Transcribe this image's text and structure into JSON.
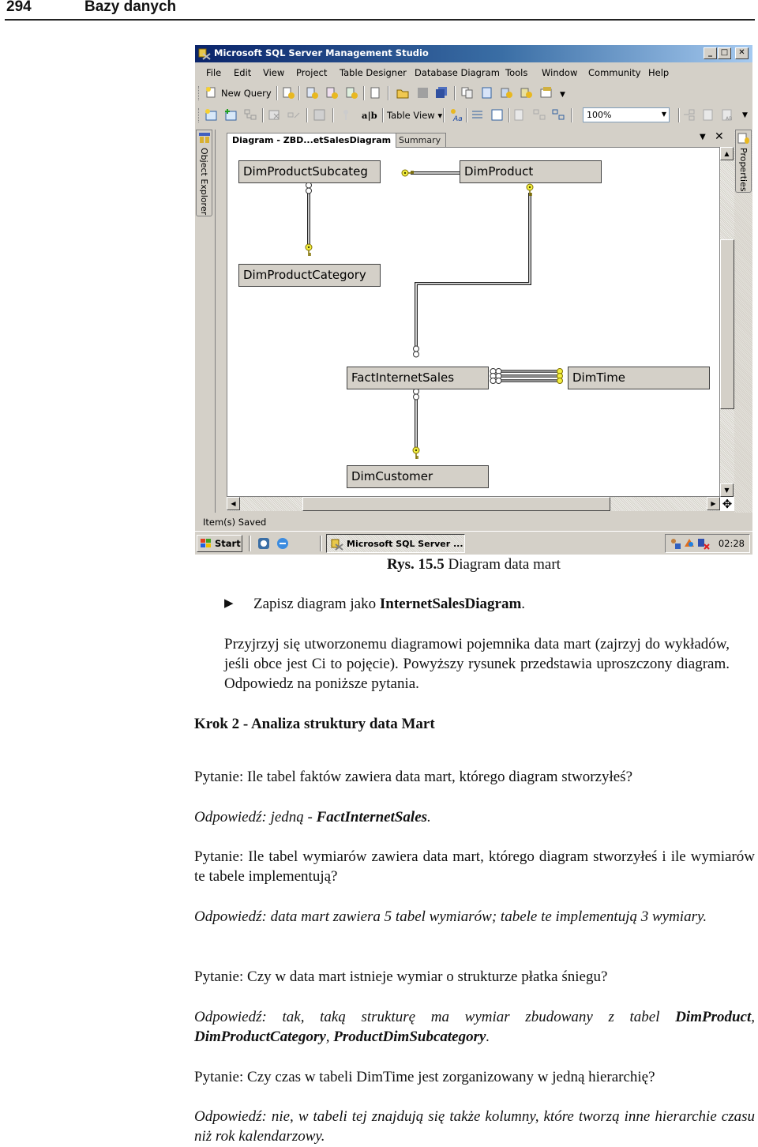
{
  "page_header": {
    "page_number": "294",
    "title": "Bazy danych"
  },
  "window": {
    "title": "Microsoft SQL Server Management Studio",
    "controls": {
      "minimize": "_",
      "maximize": "□",
      "close": "✕"
    },
    "menu": [
      "File",
      "Edit",
      "View",
      "Project",
      "Table Designer",
      "Database Diagram",
      "Tools",
      "Window",
      "Community",
      "Help"
    ],
    "toolbar1": {
      "new_query": "New Query"
    },
    "toolbar2": {
      "text_icon": "a|b",
      "table_view": "Table View ▾",
      "zoom_value": "100%"
    },
    "left_panel": "Object Explorer",
    "right_panel": "Properties",
    "tabs": [
      {
        "label": "Diagram - ZBD...etSalesDiagram",
        "active": true
      },
      {
        "label": "Summary",
        "active": false
      }
    ],
    "diagram": {
      "tables": [
        {
          "name": "DimProductSubcateg"
        },
        {
          "name": "DimProduct"
        },
        {
          "name": "DimProductCategory"
        },
        {
          "name": "FactInternetSales"
        },
        {
          "name": "DimTime"
        },
        {
          "name": "DimCustomer"
        }
      ],
      "relationships": [
        {
          "from": "DimProductSubcateg",
          "to": "DimProduct",
          "one_side": "DimProductSubcateg"
        },
        {
          "from": "DimProductCategory",
          "to": "DimProductSubcateg",
          "one_side": "DimProductCategory"
        },
        {
          "from": "DimProduct",
          "to": "FactInternetSales",
          "one_side": "DimProduct"
        },
        {
          "from": "DimTime",
          "to": "FactInternetSales",
          "one_side": "DimTime",
          "count": 3
        },
        {
          "from": "DimCustomer",
          "to": "FactInternetSales",
          "one_side": "DimCustomer"
        }
      ]
    },
    "status": "Item(s) Saved",
    "taskbar": {
      "start": "Start",
      "task": "Microsoft SQL Server ...",
      "clock": "02:28"
    }
  },
  "caption": {
    "label": "Rys. 15.5",
    "text": " Diagram data mart"
  },
  "bullet": {
    "text": "Zapisz diagram jako ",
    "bold": "InternetSalesDiagram",
    "end": "."
  },
  "intro": "Przyjrzyj się utworzonemu diagramowi pojemnika data mart (zajrzyj do wykładów, jeśli obce jest Ci to pojęcie). Powyższy rysunek przedstawia uproszczony diagram. Odpowiedz na poniższe pytania.",
  "section_heading": "Krok 2 - Analiza struktury data Mart",
  "qa": [
    {
      "q": "Pytanie: Ile tabel faktów zawiera data mart, którego diagram stworzyłeś?",
      "a_prefix": "Odpowiedź: jedną - ",
      "a_bold": "FactInternetSales",
      "a_suffix": "."
    },
    {
      "q": "Pytanie: Ile tabel wymiarów zawiera data mart, którego diagram stworzyłeś i ile wymiarów te tabele implementują?",
      "a": "Odpowiedź: data mart zawiera 5 tabel wymiarów; tabele te implementują 3 wymiary."
    },
    {
      "q": "Pytanie: Czy w data mart istnieje wymiar o strukturze płatka śniegu?",
      "a_prefix": "Odpowiedź: tak, taką strukturę ma wymiar zbudowany z tabel ",
      "a_bold1": "DimProduct",
      "a_sep1": ", ",
      "a_bold2": "DimProductCategory",
      "a_sep2": ", ",
      "a_bold3": "ProductDimSubcategory",
      "a_suffix": "."
    },
    {
      "q": "Pytanie: Czy czas w tabeli DimTime jest zorganizowany w jedną hierarchię?",
      "a": "Odpowiedź: nie, w tabeli tej znajdują się także kolumny, które tworzą inne hierarchie czasu niż rok kalendarzowy."
    }
  ]
}
